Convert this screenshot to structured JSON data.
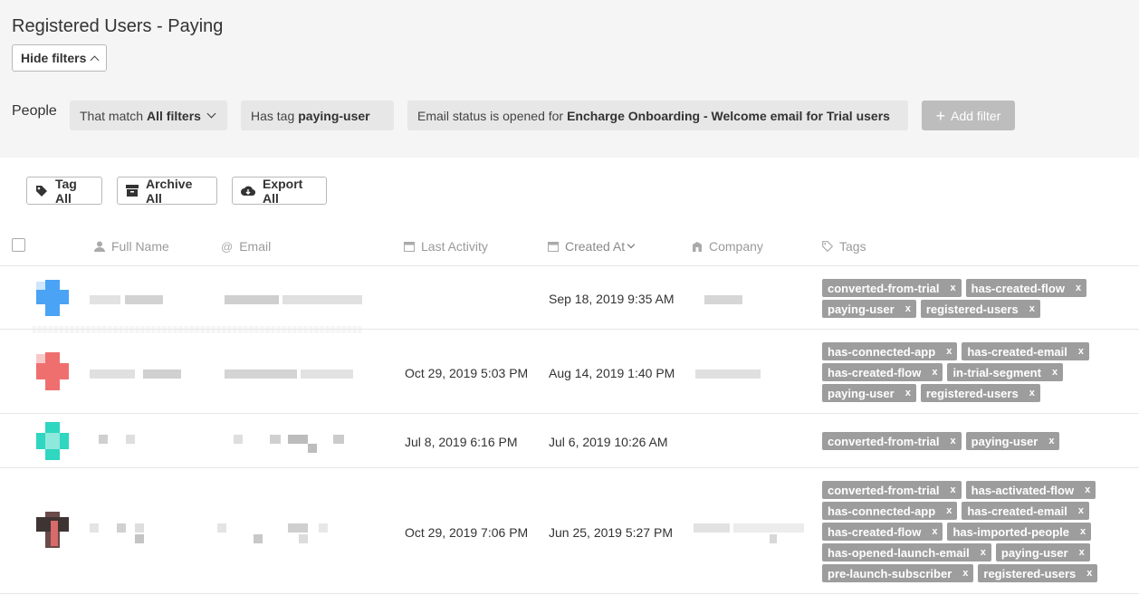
{
  "page": {
    "title": "Registered Users - Paying"
  },
  "filters": {
    "hide_label": "Hide filters",
    "people_label": "People",
    "match_prefix": "That match",
    "match_value": "All filters",
    "tag_prefix": "Has tag",
    "tag_value": "paying-user",
    "email_prefix": "Email status is opened for",
    "email_value": "Encharge Onboarding - Welcome email for Trial users",
    "add_label": "Add filter"
  },
  "actions": {
    "tag_all": "Tag All",
    "archive_all": "Archive All",
    "export_all": "Export All"
  },
  "columns": {
    "full_name": "Full Name",
    "email": "Email",
    "last_activity": "Last Activity",
    "created_at": "Created At",
    "company": "Company",
    "tags": "Tags"
  },
  "rows": [
    {
      "avatar_color": "#4aa3f5",
      "last_activity": "",
      "created_at": "Sep 18, 2019 9:35 AM",
      "tags": [
        "converted-from-trial",
        "has-created-flow",
        "paying-user",
        "registered-users"
      ]
    },
    {
      "avatar_color": "#ef6f6f",
      "last_activity": "Oct 29, 2019 5:03 PM",
      "created_at": "Aug 14, 2019 1:40 PM",
      "tags": [
        "has-connected-app",
        "has-created-email",
        "has-created-flow",
        "in-trial-segment",
        "paying-user",
        "registered-users"
      ]
    },
    {
      "avatar_color": "#2fd6c0",
      "last_activity": "Jul 8, 2019 6:16 PM",
      "created_at": "Jul 6, 2019 10:26 AM",
      "tags": [
        "converted-from-trial",
        "paying-user"
      ]
    },
    {
      "avatar_color": "#6b4a4a",
      "last_activity": "Oct 29, 2019 7:06 PM",
      "created_at": "Jun 25, 2019 5:27 PM",
      "tags": [
        "converted-from-trial",
        "has-activated-flow",
        "has-connected-app",
        "has-created-email",
        "has-created-flow",
        "has-imported-people",
        "has-opened-launch-email",
        "paying-user",
        "pre-launch-subscriber",
        "registered-users"
      ]
    }
  ],
  "tag_remove_glyph": "x",
  "add_filter_glyph": "+"
}
